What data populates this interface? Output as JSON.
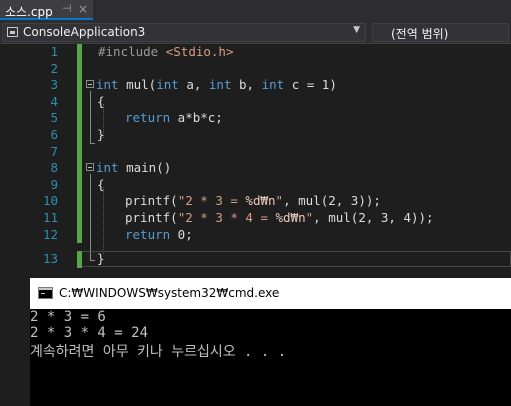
{
  "tab": {
    "label": "소스.cpp",
    "pin": "⊣",
    "close": "×"
  },
  "navbar": {
    "project": "ConsoleApplication3",
    "scope": "(전역 범위)"
  },
  "editor": {
    "line_numbers": [
      "1",
      "2",
      "3",
      "4",
      "5",
      "6",
      "7",
      "8",
      "9",
      "10",
      "11",
      "12",
      "13"
    ],
    "l1": {
      "directive": "#include",
      "header": "<Stdio.h>"
    },
    "l3": {
      "kw_int1": "int",
      "name": "mul(",
      "kw_int2": "int",
      "a": " a, ",
      "kw_int3": "int",
      "b": " b, ",
      "kw_int4": "int",
      "c": " c = 1)"
    },
    "l4": "{",
    "l5": {
      "kw_return": "return",
      "expr": " a*b*c;"
    },
    "l6": "}",
    "l8": {
      "kw_int": "int",
      "name": " main()"
    },
    "l9": "{",
    "l10": {
      "call": "printf(",
      "str": "\"2 * 3 = ",
      "fmt": "%d₩n",
      "str_end": "\"",
      "rest": ", mul(2, 3));"
    },
    "l11": {
      "call": "printf(",
      "str": "\"2 * 3 * 4 = ",
      "fmt": "%d₩n",
      "str_end": "\"",
      "rest": ", mul(2, 3, 4));"
    },
    "l12": {
      "kw_return": "return",
      "rest": " 0;"
    },
    "l13": "}"
  },
  "console": {
    "title": "C:₩WINDOWS₩system32₩cmd.exe",
    "lines": [
      "2 * 3 = 6",
      "2 * 3 * 4 = 24",
      "계속하려면 아무 키나 누르십시오 . . ."
    ]
  },
  "colors": {
    "accent": "#007acc",
    "keyword": "#569cd6",
    "string": "#d69d85",
    "line_number": "#2b91af",
    "change_bar": "#57a64a"
  }
}
